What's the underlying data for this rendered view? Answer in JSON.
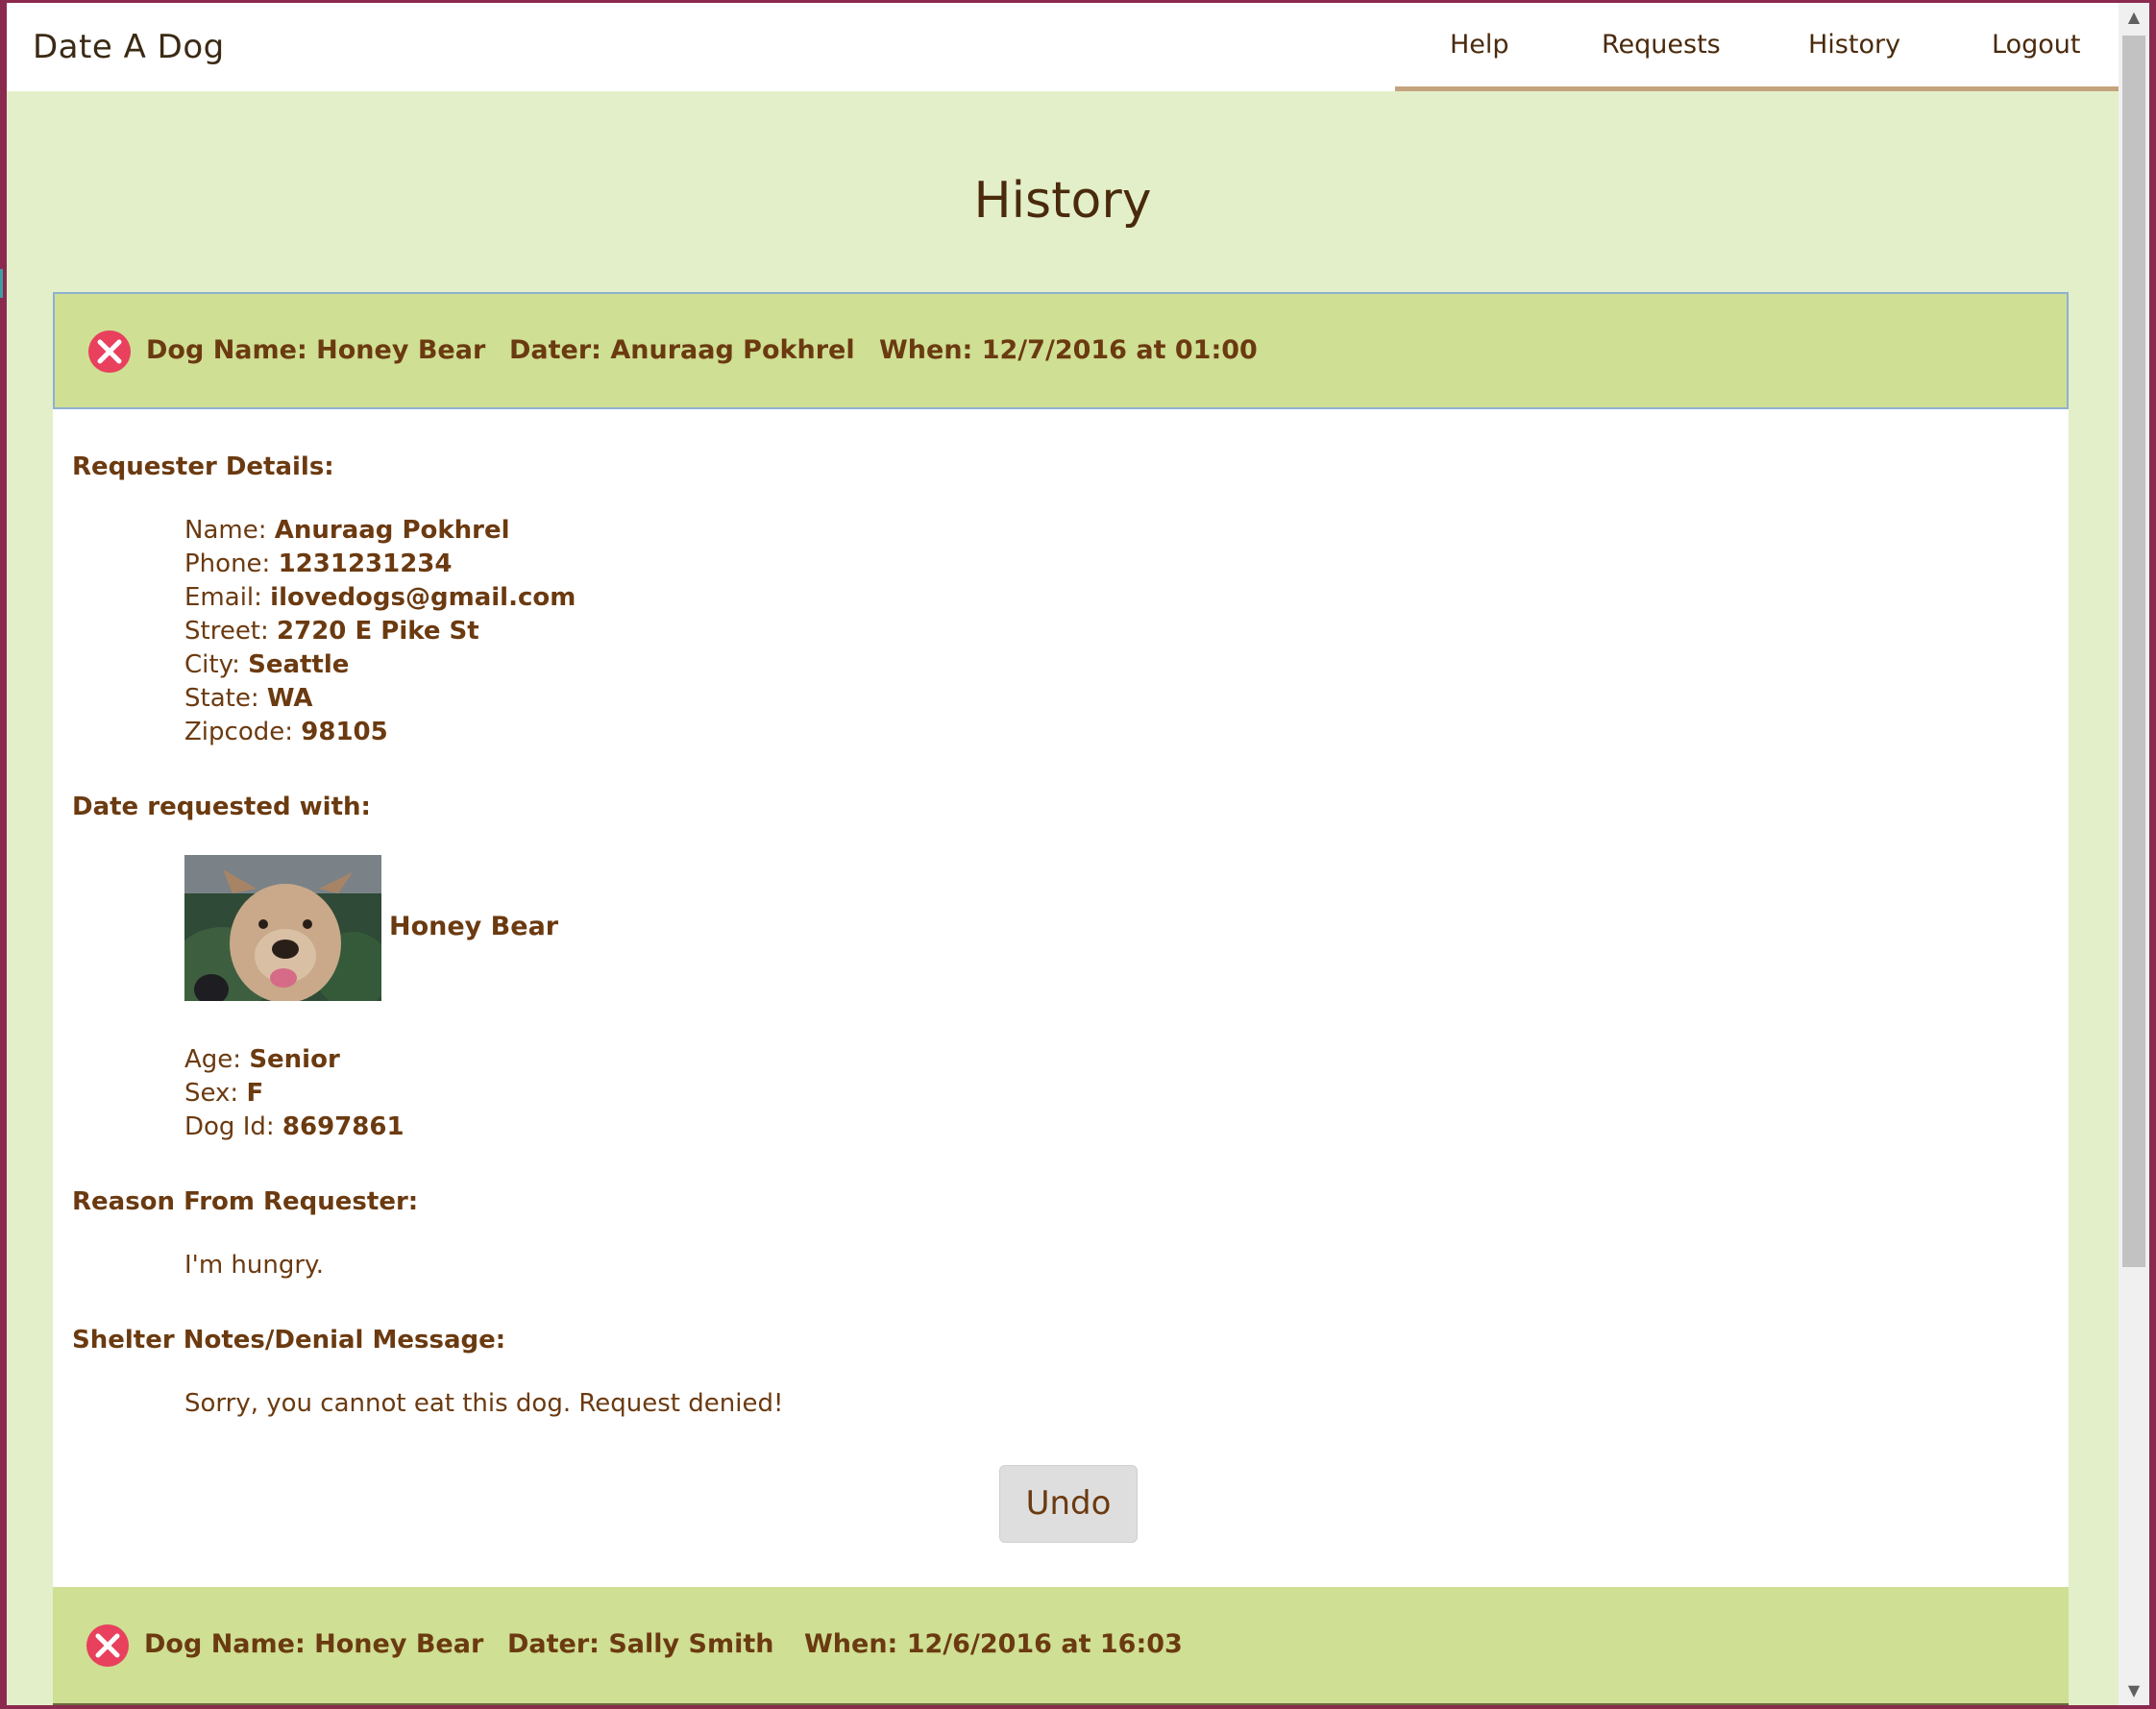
{
  "app": {
    "brand": "Date A Dog"
  },
  "nav": {
    "help": "Help",
    "requests": "Requests",
    "history": "History",
    "logout": "Logout"
  },
  "page": {
    "title": "History"
  },
  "colors": {
    "accent_green": "#cfdf94",
    "page_bg": "#e3efc9",
    "text_brown": "#6b3a10",
    "deny_red": "#e8405d",
    "nav_underline": "#c4a47c"
  },
  "entries": [
    {
      "status_icon": "close-circle-icon",
      "dog_name_label": "Dog Name: Honey Bear",
      "dater_label": "Dater: Anuraag Pokhrel",
      "when_label": "When: 12/7/2016 at 01:00",
      "requester_heading": "Requester Details:",
      "requester": {
        "name_key": "Name:",
        "name": "Anuraag Pokhrel",
        "phone_key": "Phone:",
        "phone": "1231231234",
        "email_key": "Email:",
        "email": "ilovedogs@gmail.com",
        "street_key": "Street:",
        "street": "2720 E Pike St",
        "city_key": "City:",
        "city": "Seattle",
        "state_key": "State:",
        "state": "WA",
        "zip_key": "Zipcode:",
        "zip": "98105"
      },
      "dog_heading": "Date requested with:",
      "dog": {
        "name": "Honey Bear",
        "age_key": "Age:",
        "age": "Senior",
        "sex_key": "Sex:",
        "sex": "F",
        "id_key": "Dog Id:",
        "id": "8697861"
      },
      "reason_heading": "Reason From Requester:",
      "reason": "I'm hungry.",
      "notes_heading": "Shelter Notes/Denial Message:",
      "notes": "Sorry, you cannot eat this dog. Request denied!",
      "undo_label": "Undo"
    },
    {
      "status_icon": "close-circle-icon",
      "dog_name_label": "Dog Name: Honey Bear",
      "dater_label": "Dater: Sally Smith",
      "when_label": "When: 12/6/2016 at 16:03"
    }
  ]
}
